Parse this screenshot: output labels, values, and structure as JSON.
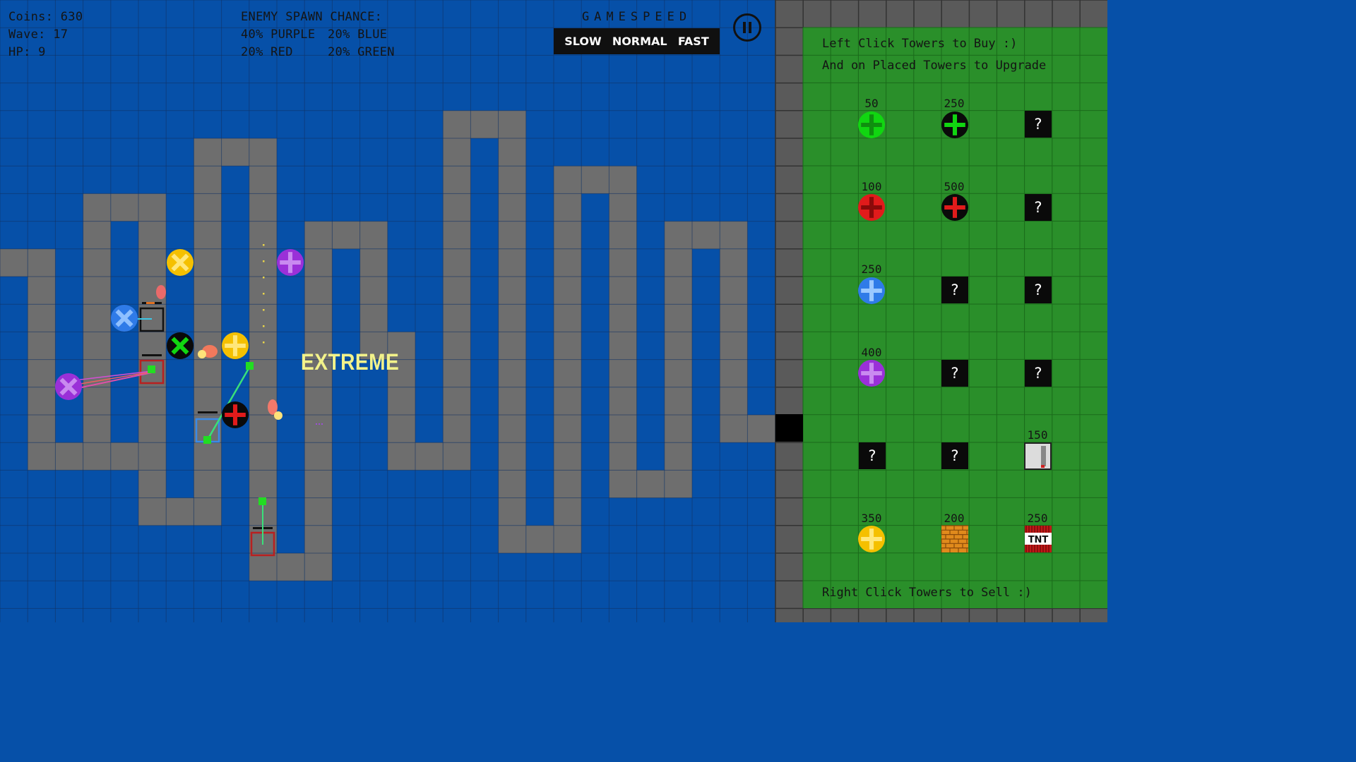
{
  "hud": {
    "coins": "Coins: 630",
    "wave": "Wave: 17",
    "hp": "HP: 9"
  },
  "spawn": {
    "title": "ENEMY SPAWN CHANCE:",
    "purple": "40% PURPLE",
    "blue": "20% BLUE",
    "red": "20% RED",
    "green": "20% GREEN"
  },
  "gamespeed": {
    "title": "GAMESPEED",
    "options": [
      "SLOW",
      "NORMAL",
      "FAST"
    ]
  },
  "difficulty": "EXTREME",
  "shop": {
    "instructions_buy": "Left Click Towers to Buy :)",
    "instructions_upgrade": "And on Placed Towers to Upgrade",
    "instructions_sell": "Right Click Towers to Sell :)",
    "locked_symbol": "?",
    "tnt_label": "TNT",
    "prices": {
      "green_1": "50",
      "green_2": "250",
      "red_1": "100",
      "red_2": "500",
      "blue_1": "250",
      "purple_1": "400",
      "wall": "150",
      "yellow": "350",
      "brick": "200",
      "tnt": "250"
    }
  },
  "colors": {
    "water": "#0650a8",
    "grid": "#2a4a7a",
    "path": "#6e6e6e",
    "shop": "#2a8f2a",
    "border": "#5a5a5a",
    "green": "#11d611",
    "red": "#e11b1b",
    "blue": "#2f7be8",
    "purple": "#9a30d8",
    "yellow": "#f5c000",
    "text_accent": "#f2f28a"
  }
}
